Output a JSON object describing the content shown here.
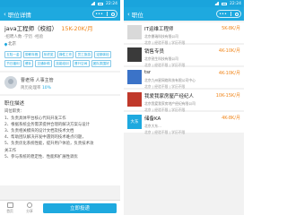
{
  "status": {
    "time": "22:24"
  },
  "detail": {
    "nav_title": "职位详情",
    "job_title": "java工程师（校招）",
    "salary": "15K-20K/月",
    "meta": "·招聘人数 ·学历 ·经验",
    "location": "北京",
    "tags": [
      "五险一金",
      "带薪年假",
      "年终奖",
      "弹性工作",
      "员工旅游",
      "定期体检",
      "节日福利",
      "餐补",
      "交通补助",
      "技能培训",
      "晋升空间",
      "团队氛围好"
    ],
    "recruiter": {
      "name": "曹老师",
      "title": "人事主管",
      "stat_label": "简历处理率",
      "stat_value": "10%"
    },
    "description": {
      "heading": "职位描述",
      "lines": [
        "岗位职责：",
        "1、负责具体平台核心代码开发工作",
        "2、根据系统业务需求提供合理的解决方案与设计",
        "3、负责相关模块的设计文档及技术文档",
        "4、帮助团队解决开发中遇到的技术难点问题，",
        "5、负责优化系统性能，提升用户体验，负责技术攻",
        "关工作",
        "5、参与系统的稳定性、性能和扩展性调优"
      ]
    },
    "bottom": {
      "home_label": "首页",
      "share_label": "分享",
      "apply_label": "立即投递"
    }
  },
  "list": {
    "nav_title": "职位",
    "items": [
      {
        "title": "IT运维工程师",
        "salary": "5K-8K/月",
        "company": "北京鼎瑞科技有限公司",
        "meta": "北京 | 经验不限 | 学历不限",
        "logo_text": "",
        "logo_color": "#d9d9d9"
      },
      {
        "title": "销售专员",
        "salary": "4K-10K/月",
        "company": "北京锐生科技有限公司",
        "meta": "北京 | 经验不限 | 学历不限",
        "logo_text": "",
        "logo_color": "#3a3a3a"
      },
      {
        "title": "tsr",
        "salary": "4K-10K/月",
        "company": "北京九州星网络科技有限公司中心",
        "meta": "北京 | 经验不限 | 学历不限",
        "logo_text": "",
        "logo_color": "#3b73c8"
      },
      {
        "title": "我爱我家房屋产经纪人",
        "salary": "10K-15K/月",
        "company": "北京我爱我家房地产经纪有限公司",
        "meta": "北京 | 经验不限 | 学历不限",
        "logo_text": "",
        "logo_color": "#c0392b"
      },
      {
        "title": "储备KA",
        "salary": "4K-8K/月",
        "company": "北京大东...",
        "meta": "北京 | 经验不限 | 学历不限",
        "logo_text": "大东",
        "logo_color": "#1ea9df"
      }
    ]
  },
  "colors": {
    "primary": "#1ea9df",
    "salary": "#f08519"
  }
}
